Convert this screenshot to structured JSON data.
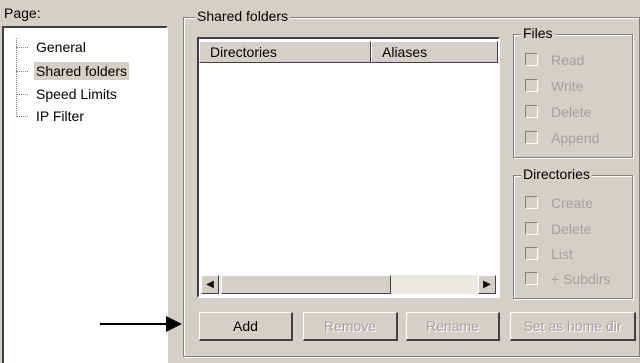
{
  "page_label": "Page:",
  "tree": {
    "items": [
      {
        "label": "General"
      },
      {
        "label": "Shared folders"
      },
      {
        "label": "Speed Limits"
      },
      {
        "label": "IP Filter"
      }
    ]
  },
  "shared_folders": {
    "title": "Shared folders",
    "columns": [
      "Directories",
      "Aliases"
    ]
  },
  "files_group": {
    "title": "Files",
    "options": [
      "Read",
      "Write",
      "Delete",
      "Append"
    ]
  },
  "directories_group": {
    "title": "Directories",
    "options": [
      "Create",
      "Delete",
      "List",
      "+ Subdirs"
    ]
  },
  "buttons": {
    "add": "Add",
    "remove": "Remove",
    "rename": "Rename",
    "set_home": "Set as home dir"
  },
  "scroll": {
    "left_icon": "◀",
    "right_icon": "▶"
  }
}
